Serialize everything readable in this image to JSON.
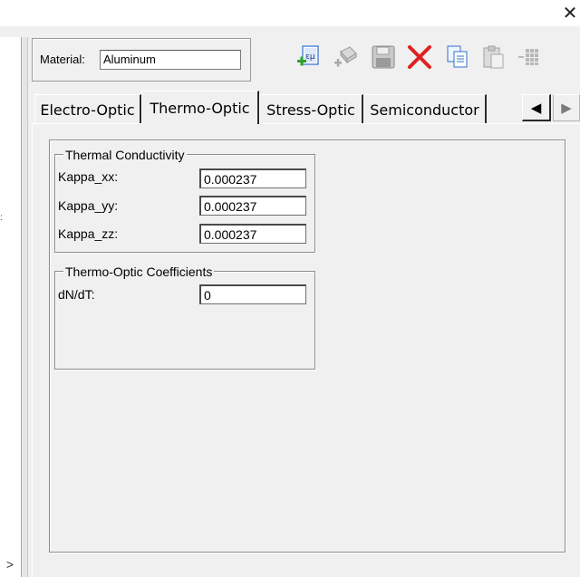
{
  "window": {
    "close_glyph": "✕"
  },
  "left_pane": {
    "dot_glyph": ":",
    "scroll_right_glyph": ">"
  },
  "material": {
    "label": "Material:",
    "value": "Aluminum"
  },
  "toolbar": {
    "items": [
      {
        "icon": "new-material-icon"
      },
      {
        "icon": "edit-material-icon"
      },
      {
        "icon": "save-icon"
      },
      {
        "icon": "delete-icon"
      },
      {
        "icon": "copy-icon"
      },
      {
        "icon": "paste-icon"
      },
      {
        "icon": "grid-icon"
      }
    ],
    "new_icon_text": "εμ"
  },
  "tabs": {
    "items": [
      {
        "label": "Electro-Optic",
        "active": false
      },
      {
        "label": "Thermo-Optic",
        "active": true
      },
      {
        "label": "Stress-Optic",
        "active": false
      },
      {
        "label": "Semiconductor",
        "active": false
      }
    ],
    "scroll_left_glyph": "◀",
    "scroll_right_glyph": "▶"
  },
  "thermal_conductivity": {
    "title": "Thermal Conductivity",
    "fields": [
      {
        "label": "Kappa_xx:",
        "value": "0.000237"
      },
      {
        "label": "Kappa_yy:",
        "value": "0.000237"
      },
      {
        "label": "Kappa_zz:",
        "value": "0.000237"
      }
    ]
  },
  "thermo_optic": {
    "title": "Thermo-Optic Coefficients",
    "fields": [
      {
        "label": "dN/dT:",
        "value": "0"
      }
    ]
  },
  "colors": {
    "delete_red": "#e02020",
    "accent_blue": "#2f6fd0",
    "save_blue": "#4a6fb0"
  }
}
